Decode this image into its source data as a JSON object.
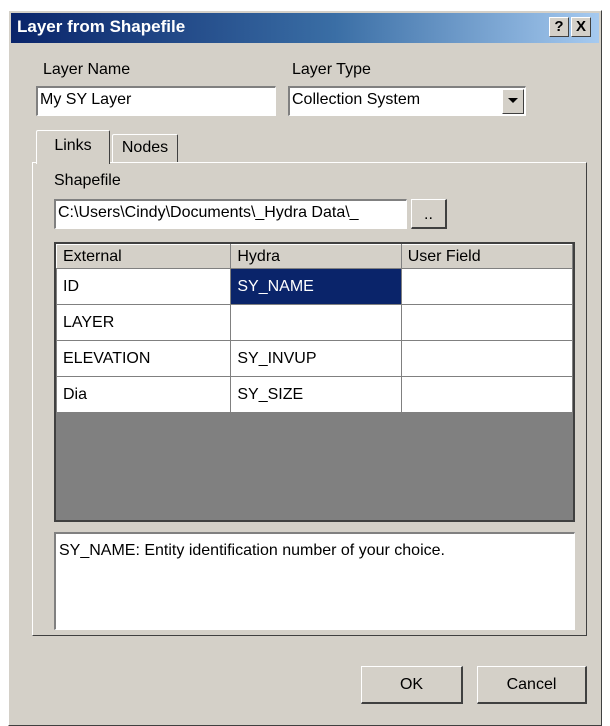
{
  "window": {
    "title": "Layer from Shapefile",
    "help_button": "?",
    "close_button": "X"
  },
  "layer_name": {
    "label": "Layer Name",
    "value": "My SY Layer"
  },
  "layer_type": {
    "label": "Layer Type",
    "value": "Collection System"
  },
  "tabs": [
    {
      "label": "Links",
      "active": true
    },
    {
      "label": "Nodes",
      "active": false
    }
  ],
  "shapefile": {
    "label": "Shapefile",
    "value": "C:\\Users\\Cindy\\Documents\\_Hydra Data\\_",
    "browse_label": ".."
  },
  "grid": {
    "columns": [
      "External",
      "Hydra",
      "User Field"
    ],
    "rows": [
      {
        "external": "ID",
        "hydra": "SY_NAME",
        "user_field": "",
        "selected_column": "hydra"
      },
      {
        "external": "LAYER",
        "hydra": "",
        "user_field": ""
      },
      {
        "external": "ELEVATION",
        "hydra": "SY_INVUP",
        "user_field": ""
      },
      {
        "external": "Dia",
        "hydra": "SY_SIZE",
        "user_field": ""
      }
    ]
  },
  "description": "SY_NAME: Entity identification number of your choice.",
  "buttons": {
    "ok": "OK",
    "cancel": "Cancel"
  },
  "colors": {
    "selection": "#0a246a",
    "face": "#d4d0c8",
    "title_gradient_start": "#0a246a"
  }
}
